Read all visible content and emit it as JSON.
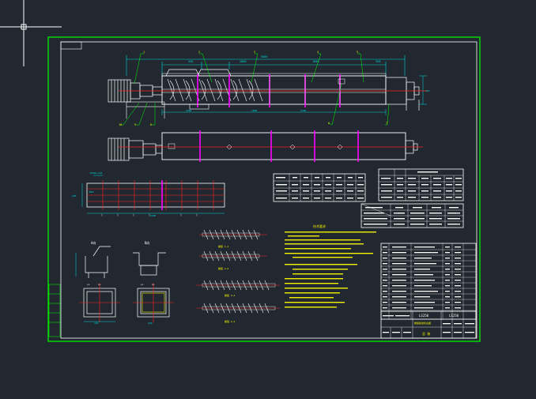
{
  "colors": {
    "background": "#212830",
    "frame": "#00ff00",
    "border": "#ffffff",
    "outline": "#ffffff",
    "centerline": "#ff2020",
    "stiffener": "#ff00ff",
    "dimension": "#00d6d6",
    "label": "#f2f200"
  },
  "cursor": {
    "icon": "crosshair-cursor-icon"
  },
  "title_block": {
    "drawing_name": "LS250",
    "subtitle": "螺旋输送机总图",
    "drawing_no": "LS250",
    "sheet_label": "总 装"
  },
  "technical_requirements": {
    "heading": "技术要求"
  },
  "section_labels": {
    "view_a": "A向",
    "view_b": "B向"
  },
  "views": {
    "main_elevation": "主视图",
    "plan_view": "俯视图",
    "foot_view": "支座视图",
    "spiral_1": "螺旋轴 1",
    "spiral_2": "螺旋轴 2",
    "spiral_3": "螺旋轴 3",
    "spiral_4": "螺旋轴 4"
  },
  "parts_list_heading": "明细表",
  "spec_tables": [
    "参数表 1",
    "参数表 2"
  ]
}
